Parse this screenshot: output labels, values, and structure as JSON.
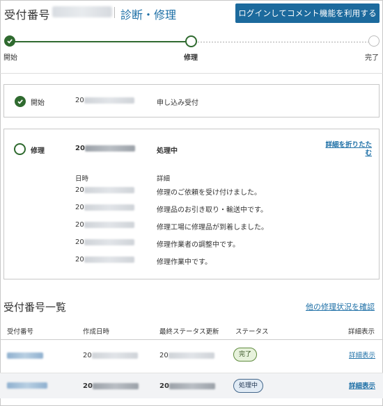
{
  "header": {
    "title": "受付番号",
    "service": "診断・修理",
    "login_button": "ログインしてコメント機能を利用する"
  },
  "stepper": {
    "steps": [
      {
        "label": "開始",
        "state": "done"
      },
      {
        "label": "修理",
        "state": "current"
      },
      {
        "label": "完了",
        "state": "todo"
      }
    ]
  },
  "card_start": {
    "step": "開始",
    "date_prefix": "20",
    "detail": "申し込み受付"
  },
  "card_repair": {
    "step": "修理",
    "date_prefix": "20",
    "status": "処理中",
    "collapse_link": "詳細を折りたたむ",
    "col_date": "日時",
    "col_detail": "詳細",
    "history": [
      {
        "date_prefix": "20",
        "detail": "修理のご依頼を受け付けました。"
      },
      {
        "date_prefix": "20",
        "detail": "修理品のお引き取り・輸送中です。"
      },
      {
        "date_prefix": "20",
        "detail": "修理工場に修理品が到着しました。"
      },
      {
        "date_prefix": "20",
        "detail": "修理作業者の調整中です。"
      },
      {
        "date_prefix": "20",
        "detail": "修理作業中です。"
      }
    ]
  },
  "list": {
    "title": "受付番号一覧",
    "other_link": "他の修理状況を確認",
    "headers": {
      "number": "受付番号",
      "created": "作成日時",
      "updated": "最終ステータス更新",
      "status": "ステータス",
      "detail": "詳細表示"
    },
    "rows": [
      {
        "created_prefix": "20",
        "updated_prefix": "20",
        "status": "完了",
        "detail_link": "詳細表示"
      },
      {
        "created_prefix": "20",
        "updated_prefix": "20",
        "status": "処理中",
        "detail_link": "詳細表示"
      }
    ]
  },
  "colors": {
    "accent": "#1c6a9d",
    "link": "#1d6fa6",
    "progress": "#2f6a2f"
  }
}
